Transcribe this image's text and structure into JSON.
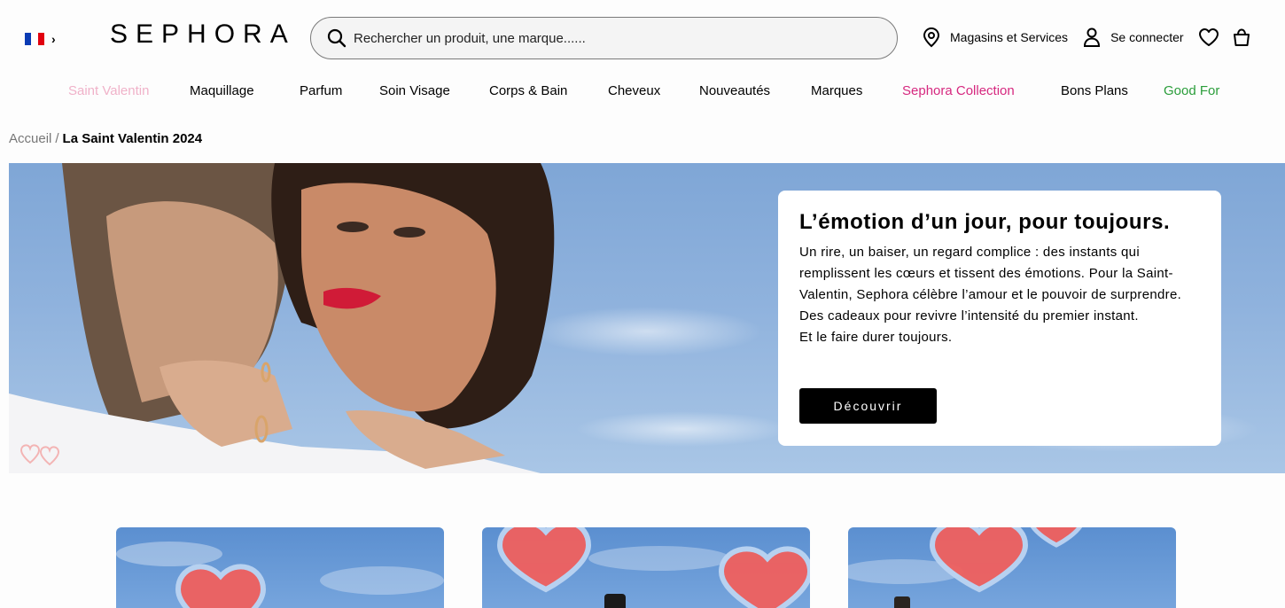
{
  "header": {
    "locale": {
      "flag": [
        "#0b3bb4",
        "#ffffff",
        "#e1000f"
      ]
    },
    "logo": "SEPHORA",
    "search": {
      "placeholder": "Rechercher un produit, une marque......"
    },
    "stores_label": "Magasins et Services",
    "account_label": "Se connecter",
    "icons": [
      "location-pin-icon",
      "user-icon",
      "heart-icon",
      "basket-icon",
      "search-icon"
    ]
  },
  "nav": {
    "items": [
      {
        "label": "Saint Valentin",
        "color": "#f0b2c9"
      },
      {
        "label": "Maquillage",
        "color": "#000000"
      },
      {
        "label": "Parfum",
        "color": "#000000"
      },
      {
        "label": "Soin Visage",
        "color": "#000000"
      },
      {
        "label": "Corps & Bain",
        "color": "#000000"
      },
      {
        "label": "Cheveux",
        "color": "#000000"
      },
      {
        "label": "Nouveautés",
        "color": "#000000"
      },
      {
        "label": "Marques",
        "color": "#000000"
      },
      {
        "label": "Sephora Collection",
        "color": "#d6287f"
      },
      {
        "label": "Bons Plans",
        "color": "#000000"
      },
      {
        "label": "Good For",
        "color": "#2a9d3a"
      }
    ]
  },
  "breadcrumb": {
    "home": "Accueil",
    "separator": "/",
    "current": "La Saint Valentin 2024"
  },
  "hero": {
    "title": "L’émotion d’un jour, pour toujours.",
    "text": "Un rire, un baiser, un regard complice : des instants qui remplissent les cœurs et tissent des émotions. Pour la Saint-Valentin, Sephora célèbre l’amour et le pouvoir de surprendre. Des cadeaux pour revivre l’intensité du premier instant.",
    "text2": "Et le faire durer toujours.",
    "button": "Découvrir"
  },
  "tiles": {
    "count": 3
  }
}
